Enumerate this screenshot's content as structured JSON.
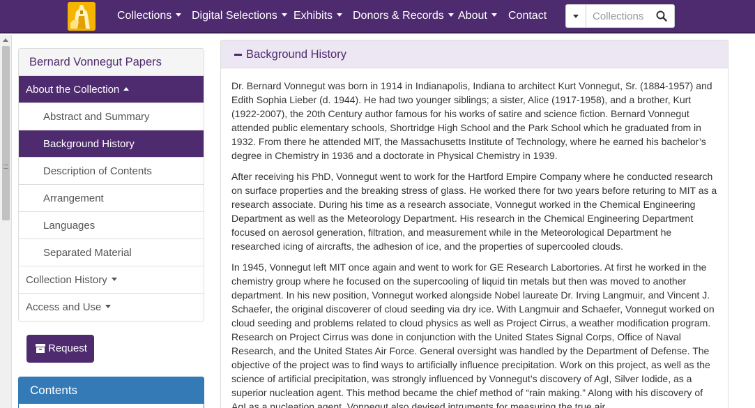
{
  "navbar": {
    "logo_icon": "university-tower-logo-icon",
    "items": [
      {
        "label": "Collections",
        "has_dropdown": true
      },
      {
        "label": "Digital Selections",
        "has_dropdown": true
      },
      {
        "label": "Exhibits",
        "has_dropdown": true
      },
      {
        "label": "Donors & Records",
        "has_dropdown": true
      },
      {
        "label": "About",
        "has_dropdown": true
      },
      {
        "label": "Contact",
        "has_dropdown": false
      }
    ],
    "search": {
      "placeholder": "Collections",
      "value": "",
      "button_icon": "search-icon",
      "toggle_icon": "chevron-down-icon"
    },
    "color": "#4e2a6f"
  },
  "sidebar": {
    "title": "Bernard Vonnegut Papers",
    "items": [
      {
        "label": "About the Collection",
        "level": 1,
        "active": true,
        "caret": "up"
      },
      {
        "label": "Abstract and Summary",
        "level": 2,
        "active": false
      },
      {
        "label": "Background History",
        "level": 2,
        "active": true
      },
      {
        "label": "Description of Contents",
        "level": 2,
        "active": false
      },
      {
        "label": "Arrangement",
        "level": 2,
        "active": false
      },
      {
        "label": "Languages",
        "level": 2,
        "active": false
      },
      {
        "label": "Separated Material",
        "level": 2,
        "active": false
      },
      {
        "label": "Collection History",
        "level": 1,
        "active": false,
        "caret": "down"
      },
      {
        "label": "Access and Use",
        "level": 1,
        "active": false,
        "caret": "down"
      }
    ],
    "request_button": {
      "label": "Request",
      "icon": "archive-box-icon"
    },
    "contents_title": "Contents"
  },
  "main": {
    "heading": "Background History",
    "toggle_icon": "minus-icon",
    "paragraphs": [
      "Dr. Bernard Vonnegut was born in 1914 in Indianapolis, Indiana to architect Kurt Vonnegut, Sr. (1884-1957) and Edith Sophia Lieber (d. 1944). He had two younger siblings; a sister, Alice (1917-1958), and a brother, Kurt (1922-2007), the 20th Century author famous for his works of satire and science fiction. Bernard Vonnegut attended public elementary schools, Shortridge High School and the Park School which he graduated from in 1932. From there he attended MIT, the Massachusetts Institute of Technology, where he earned his bachelor’s degree in Chemistry in 1936 and a doctorate in Physical Chemistry in 1939.",
      "After receiving his PhD, Vonnegut went to work for the Hartford Empire Company where he conducted research on surface properties and the breaking stress of glass. He worked there for two years before returing to MIT as a research associate. During his time as a research associate, Vonnegut worked in the Chemical Engineering Department as well as the Meteorology Department. His research in the Chemical Engineering Department focused on aerosol generation, filtration, and measurement while in the Meteorological Department he researched icing of aircrafts, the adhesion of ice, and the properties of supercooled clouds.",
      "In 1945, Vonnegut left MIT once again and went to work for GE Research Labortories. At first he worked in the chemistry group where he focused on the supercooling of liquid tin metals but then was moved to another department. In his new position, Vonnegut worked alongside Nobel laureate Dr. Irving Langmuir, and Vincent J. Schaefer, the original discoverer of cloud seeding via dry ice. With Langmuir and Schaefer, Vonnegut worked on cloud seeding and problems related to cloud physics as well as Project Cirrus, a weather modification program. Research on Project Cirrus was done in conjunction with the United States Signal Corps, Office of Naval Research, and the United States Air Force. General oversight was handled by the Department of Defense. The objective of the project was to find ways to artificially influence precipitation. Work on this project, as well as the science of artificial precipitation, was strongly influenced by Vonnegut’s discovery of AgI, Silver Iodide, as a superior nucleation agent. This method became the chief method of “rain making.” Along with his discovery of AgI as a nucleation agent, Vonnegut also devised intruments for measuring the true air"
    ]
  }
}
